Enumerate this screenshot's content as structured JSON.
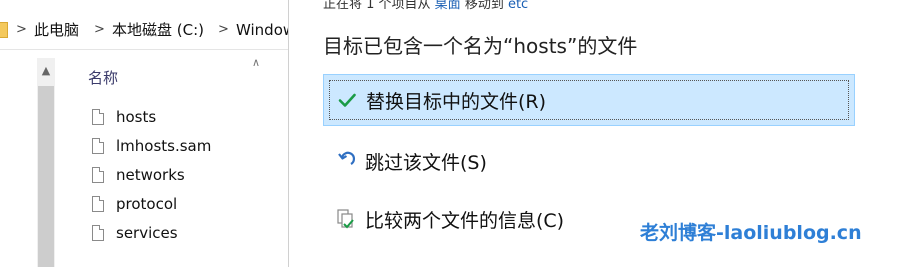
{
  "explorer": {
    "breadcrumb": [
      "此电脑",
      "本地磁盘 (C:)",
      "Window"
    ],
    "column_header": "名称",
    "files": [
      "hosts",
      "lmhosts.sam",
      "networks",
      "protocol",
      "services"
    ]
  },
  "dialog": {
    "top_line": {
      "prefix": "正在将 1 个项目从 ",
      "source": "桌面",
      "middle": " 移动到 ",
      "dest": "etc"
    },
    "heading": "目标已包含一个名为“hosts”的文件",
    "options": [
      {
        "label": "替换目标中的文件(R)",
        "icon": "check-icon"
      },
      {
        "label": "跳过该文件(S)",
        "icon": "skip-icon"
      },
      {
        "label": "比较两个文件的信息(C)",
        "icon": "compare-icon"
      }
    ]
  },
  "watermark": "老刘博客-laoliublog.cn",
  "colors": {
    "accent": "#2e7fd6",
    "selection": "#cce8ff",
    "check": "#1a9b46"
  }
}
